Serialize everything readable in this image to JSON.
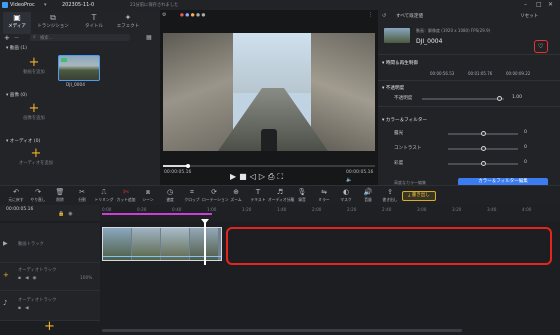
{
  "titlebar": {
    "app_name": "VideoProc",
    "project": "202305-11-0",
    "status": "21分前に保存されました",
    "win_controls": [
      "–",
      "□",
      "✕"
    ]
  },
  "left_panel": {
    "tabs": [
      {
        "label": "メディア",
        "icon": "media-icon"
      },
      {
        "label": "トランジション",
        "icon": "transition-icon"
      },
      {
        "label": "タイトル",
        "icon": "title-icon"
      },
      {
        "label": "エフェクト",
        "icon": "effect-icon"
      }
    ],
    "sections": [
      {
        "label": "動画 (1)",
        "items": [
          {
            "label": "動画を追加",
            "type": "add"
          },
          {
            "label": "DJI_0004",
            "type": "clip"
          }
        ]
      },
      {
        "label": "画像 (0)",
        "items": [
          {
            "label": "画像を追加",
            "type": "add"
          }
        ]
      },
      {
        "label": "オーディオ (0)",
        "items": [
          {
            "label": "オーディオを追加",
            "type": "add"
          }
        ]
      }
    ],
    "search_placeholder": "検索..."
  },
  "preview": {
    "time_current": "00:00:05.16",
    "time_total": "00:00:05.16",
    "progress": 0.12,
    "controls": [
      "play",
      "stop",
      "prev-frame",
      "next-frame",
      "snapshot",
      "fullscreen"
    ]
  },
  "right_panel": {
    "header": "すべて既定値",
    "reset_label": "リセット",
    "media_info": {
      "name": "DJI_0004",
      "format": "動画：解像度 (1920 x 1080)  FPS(29.9)"
    },
    "section_timing": "時間＆再生制御",
    "timing": {
      "start": "00:00:56.53",
      "end": "00:01:05.76",
      "duration": "00:00:09.22"
    },
    "section_opacity": "不透明度",
    "opacity": {
      "label": "不透明度",
      "value": "1.00",
      "level": 0.95
    },
    "section_color": "カラー＆フィルター",
    "color_rows": [
      {
        "label": "露光",
        "value": "0",
        "level": 0.5
      },
      {
        "label": "コントラスト",
        "value": "0",
        "level": 0.5
      },
      {
        "label": "彩度",
        "value": "0",
        "level": 0.5
      }
    ],
    "color_edit_link": "高度なカラー編集",
    "color_edit_button": "カラー＆フィルター編集",
    "export_button": "書き出し"
  },
  "toolbar": {
    "tools": [
      {
        "label": "元に戻す",
        "icon": "undo-icon"
      },
      {
        "label": "やり直し",
        "icon": "redo-icon"
      },
      {
        "label": "削除",
        "icon": "delete-icon"
      },
      {
        "label": "分割",
        "icon": "split-icon"
      },
      {
        "label": "トリミング",
        "icon": "trim-icon"
      },
      {
        "label": "カット追加",
        "icon": "cut-icon"
      },
      {
        "label": "シーン",
        "icon": "scene-icon"
      },
      {
        "label": "速度",
        "icon": "speed-icon"
      },
      {
        "label": "クロップ",
        "icon": "crop-icon"
      },
      {
        "label": "ローテーション",
        "icon": "rotate-icon"
      },
      {
        "label": "ズーム",
        "icon": "zoom-icon"
      },
      {
        "label": "テキスト",
        "icon": "text-icon"
      },
      {
        "label": "オーディオ分離",
        "icon": "audio-split-icon"
      },
      {
        "label": "録音",
        "icon": "record-icon"
      },
      {
        "label": "ミラー",
        "icon": "mirror-icon"
      },
      {
        "label": "マスク",
        "icon": "mask-icon"
      },
      {
        "label": "音量",
        "icon": "volume-icon"
      },
      {
        "label": "書き出し",
        "icon": "export-icon"
      }
    ]
  },
  "timeline": {
    "timecode": "00:00:05.16",
    "ruler": [
      "0:00",
      "0:20",
      "0:40",
      "1:00",
      "1:20",
      "1:40",
      "2:00",
      "2:20",
      "2:40",
      "3:00",
      "3:20",
      "3:40",
      "4:00"
    ],
    "tracks": [
      {
        "name": "動画トラック",
        "icon": "video-track-icon"
      },
      {
        "name": "オーディオトラック",
        "icon": "audio-track-icon"
      },
      {
        "name": "オーディオトラック",
        "icon": "music-track-icon"
      }
    ],
    "zoom_label": "100%"
  }
}
